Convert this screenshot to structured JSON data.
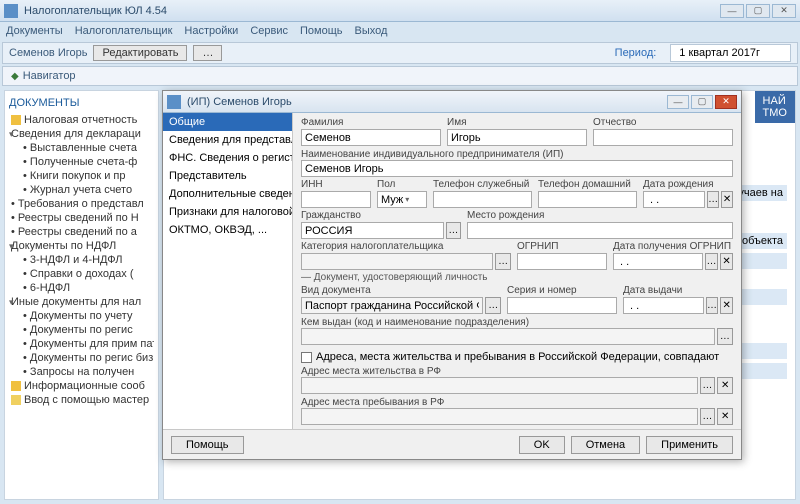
{
  "app": {
    "title": "Налогоплательщик ЮЛ 4.54"
  },
  "menu": {
    "m1": "Документы",
    "m2": "Налогоплательщик",
    "m3": "Настройки",
    "m4": "Сервис",
    "m5": "Помощь",
    "m6": "Выход"
  },
  "toolbar": {
    "user": "Семенов Игорь",
    "edit": "Редактировать",
    "period_label": "Период:",
    "period_value": "1 квартал 2017г"
  },
  "nav": {
    "label": "Навигатор"
  },
  "sidebar": {
    "heading": "ДОКУМЕНТЫ",
    "items": [
      "Налоговая отчетность",
      "Сведения для деклараци",
      "Выставленные счета",
      "Полученные счета-ф",
      "Книги покупок и пр",
      "Журнал учета счето",
      "Требования о представл",
      "Реестры сведений по Н",
      "Реестры сведений по а",
      "Документы по НДФЛ",
      "3-НДФЛ и 4-НДФЛ",
      "Справки о доходах (",
      "6-НДФЛ",
      "Иные документы для нал",
      "Документы по учету",
      "Документы по регис",
      "Документы для прим патентной системы",
      "Документы по регис бизнеса",
      "Запросы на получен",
      "Информационные сооб",
      "Ввод с помощью мастер"
    ]
  },
  "hint": {
    "l1": "НАЙ",
    "l2": "ТМО"
  },
  "strips": {
    "s1": "ие от несчастных случаев на",
    "s2": "Сбор за пользование объекта"
  },
  "modal": {
    "title": "(ИП) Семенов Игорь",
    "nav": [
      "Общие",
      "Сведения для представл",
      "ФНС. Сведения о регистра",
      "Представитель",
      "Дополнительные сведения",
      "Признаки для налоговой",
      "ОКТМО, ОКВЭД, ..."
    ],
    "labels": {
      "fam": "Фамилия",
      "name": "Имя",
      "otch": "Отчество",
      "ip": "Наименование индивидуального предпринимателя (ИП)",
      "inn": "ИНН",
      "pol": "Пол",
      "tel_s": "Телефон служебный",
      "tel_d": "Телефон домашний",
      "dob": "Дата рождения",
      "citizen": "Гражданство",
      "birthplace": "Место рождения",
      "category": "Категория налогоплательщика",
      "ogrnip": "ОГРНИП",
      "ogrnip_date": "Дата получения ОГРНИП",
      "doc_sect": "— Документ, удостоверяющий личность",
      "doc_type": "Вид документа",
      "serial": "Серия и номер",
      "issue_date": "Дата выдачи",
      "issued_by": "Кем выдан (код и наименование подразделения)",
      "addr_same": "Адреса, места жительства и пребывания в Российской Федерации, совпадают",
      "addr_reg": "Адрес места жительства в РФ",
      "addr_live": "Адрес места пребывания в РФ"
    },
    "values": {
      "fam": "Семенов",
      "name": "Игорь",
      "otch": "",
      "ip": "Семенов Игорь",
      "inn": "",
      "pol": "Муж",
      "tel_s": "",
      "tel_d": "",
      "dob": " . .",
      "citizen": "РОССИЯ",
      "birthplace": "",
      "category": "",
      "ogrnip": "",
      "ogrnip_date": " . .",
      "doc_type": "Паспорт гражданина Российской Федерации",
      "serial": "",
      "issue_date": " . .",
      "issued_by": "",
      "addr_reg": "",
      "addr_live": ""
    },
    "footer": {
      "help": "Помощь",
      "ok": "OK",
      "cancel": "Отмена",
      "apply": "Применить"
    }
  }
}
